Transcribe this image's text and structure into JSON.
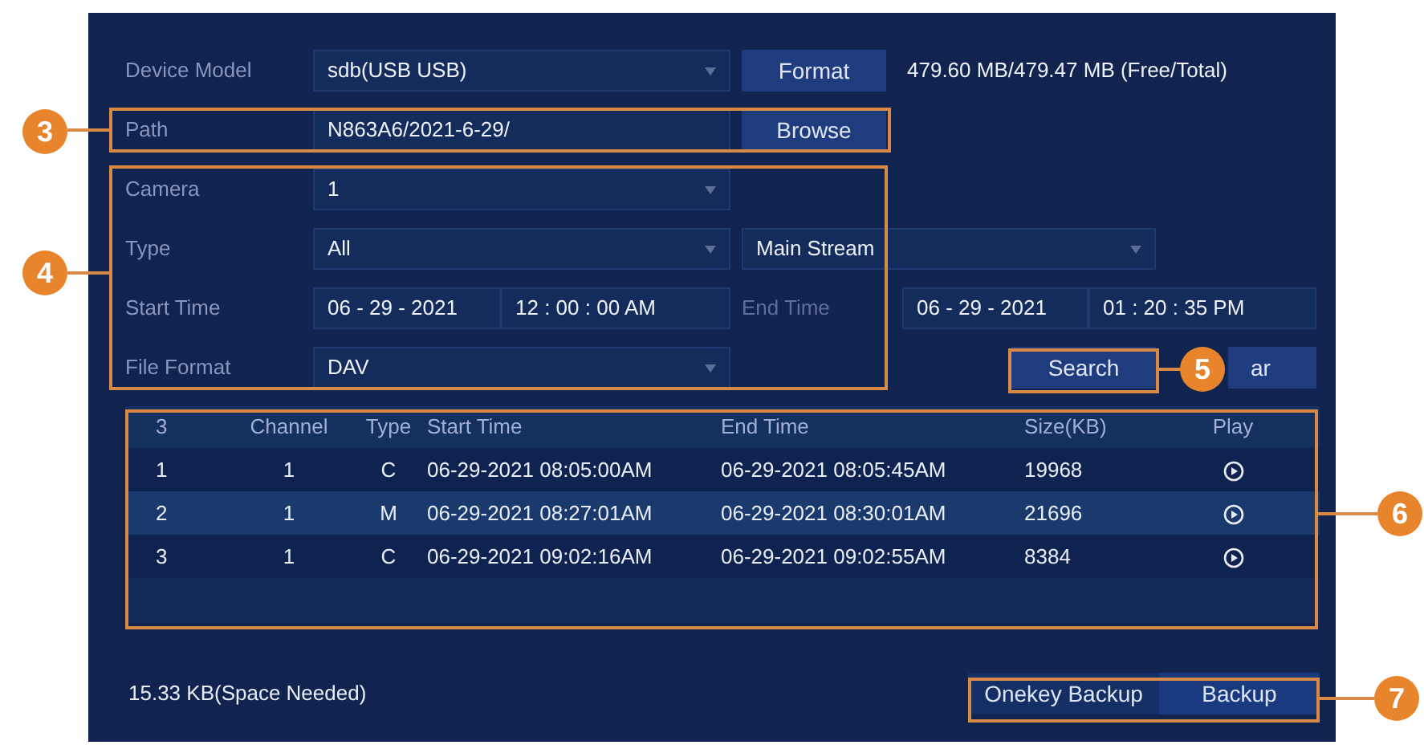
{
  "device_model": {
    "label": "Device Model",
    "value": "sdb(USB USB)"
  },
  "format_button": "Format",
  "storage": "479.60 MB/479.47 MB (Free/Total)",
  "path": {
    "label": "Path",
    "value": "N863A6/2021-6-29/"
  },
  "browse_button": "Browse",
  "camera": {
    "label": "Camera",
    "value": "1"
  },
  "type": {
    "label": "Type",
    "value": "All",
    "stream": "Main Stream"
  },
  "start_time": {
    "label": "Start Time",
    "date": "06 - 29 - 2021",
    "time": "12 : 00 : 00 AM"
  },
  "end_time": {
    "label": "End Time",
    "date": "06 - 29 - 2021",
    "time": "01 : 20 : 35 PM"
  },
  "file_format": {
    "label": "File Format",
    "value": "DAV"
  },
  "search_buttons": [
    "Search",
    "ar"
  ],
  "table": {
    "columns": [
      "3",
      "Channel",
      "Type",
      "Start Time",
      "End Time",
      "Size(KB)",
      "Play"
    ],
    "rows": [
      {
        "cells": [
          "1",
          "1",
          "C",
          "06-29-2021 08:05:00AM",
          "06-29-2021 08:05:45AM",
          "19968"
        ]
      },
      {
        "cells": [
          "2",
          "1",
          "M",
          "06-29-2021 08:27:01AM",
          "06-29-2021 08:30:01AM",
          "21696"
        ]
      },
      {
        "cells": [
          "3",
          "1",
          "C",
          "06-29-2021 09:02:16AM",
          "06-29-2021 09:02:55AM",
          "8384"
        ]
      }
    ]
  },
  "space_needed": "15.33 KB(Space Needed)",
  "backup_buttons": [
    "Onekey Backup",
    "Backup"
  ],
  "callouts": [
    "3",
    "4",
    "5",
    "6",
    "7"
  ]
}
